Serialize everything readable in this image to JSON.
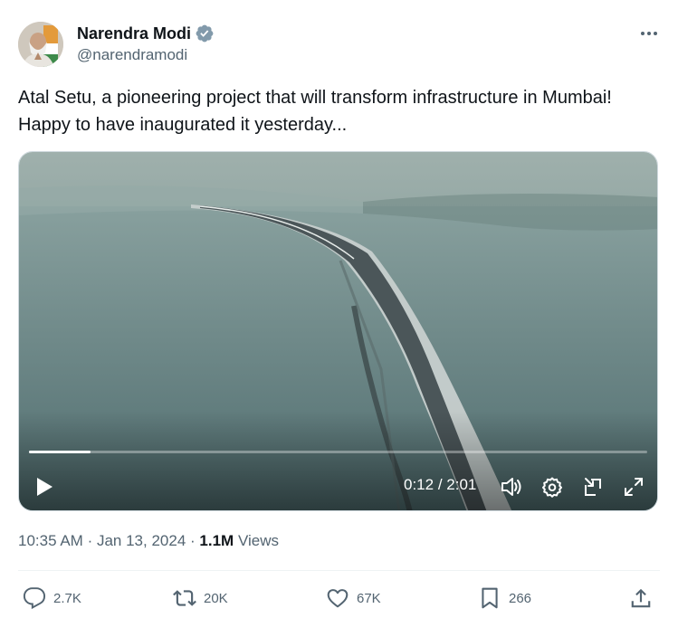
{
  "author": {
    "name": "Narendra Modi",
    "handle": "@narendramodi",
    "verified_color": "#829aab"
  },
  "tweet": {
    "text": "Atal Setu, a pioneering project that will transform infrastructure in Mumbai! Happy to have inaugurated it yesterday..."
  },
  "video": {
    "current_time": "0:12",
    "separator": " / ",
    "duration": "2:01",
    "progress_fraction": 0.099,
    "icons": [
      "play-icon",
      "volume-icon",
      "settings-icon",
      "picture-in-picture-icon",
      "fullscreen-icon"
    ]
  },
  "meta": {
    "time": "10:35 AM",
    "dot": "·",
    "date": "Jan 13, 2024",
    "views_count": "1.1M",
    "views_label": "Views"
  },
  "actions": {
    "replies": "2.7K",
    "reposts": "20K",
    "likes": "67K",
    "bookmarks": "266"
  },
  "colors": {
    "text": "#0f1419",
    "muted": "#536471",
    "border": "#cfd9de"
  }
}
